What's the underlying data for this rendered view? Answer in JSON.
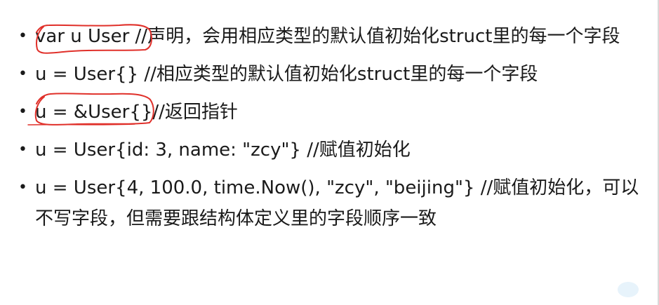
{
  "bullets": [
    {
      "text": "var u User //声明，会用相应类型的默认值初始化struct里的每一个字段"
    },
    {
      "text": "u = User{} //相应类型的默认值初始化struct里的每一个字段"
    },
    {
      "text": "u = &User{}//返回指针"
    },
    {
      "text": "u = User{id: 3, name: \"zcy\"} //赋值初始化"
    },
    {
      "text": "u = User{4, 100.0, time.Now(), \"zcy\", \"beijing\"} //赋值初始化，可以不写字段，但需要跟结构体定义里的字段顺序一致"
    }
  ],
  "bullet_symbol": "•",
  "annotation_color": "#e0302a"
}
